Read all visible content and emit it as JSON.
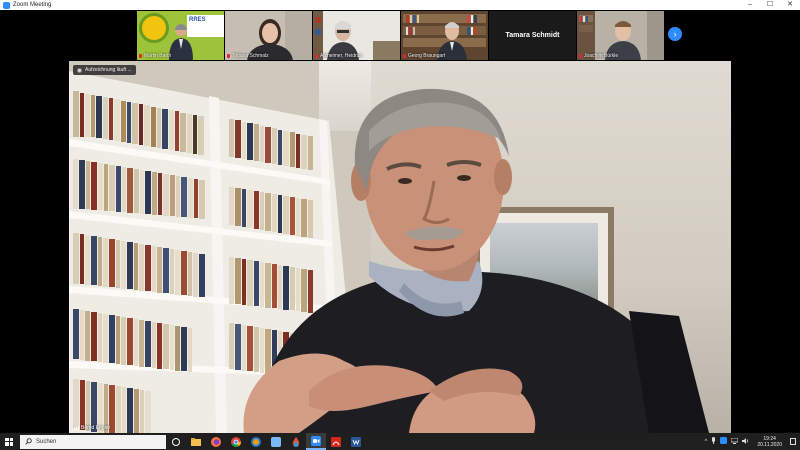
{
  "window": {
    "title": "Zoom Meeting",
    "controls": [
      "–",
      "☐",
      "✕"
    ]
  },
  "thumbnails": [
    {
      "name": "Martin Barth",
      "muted": true,
      "banner_text": "RRES"
    },
    {
      "name": "Tatjana Schmalz",
      "muted": true
    },
    {
      "name": "Alzheimer, Heidrun",
      "muted": true
    },
    {
      "name": "Georg Braungart",
      "muted": true
    },
    {
      "name": "Tamara Schmidt",
      "video_off": true
    },
    {
      "name": "Joachim Bürkle",
      "muted": true
    }
  ],
  "next_page_icon": "›",
  "main": {
    "recording_label": "Aufzeichnung läuft ...",
    "speaker_name": "Bernd Engler"
  },
  "taskbar": {
    "search_placeholder": "Suchen",
    "apps": [
      "task-view",
      "file-explorer",
      "firefox",
      "chrome",
      "firefox-alt",
      "zoom-alt",
      "drop",
      "zoom",
      "acrobat",
      "word"
    ],
    "active_app": "zoom",
    "tray_symbols": [
      "^",
      "🔊"
    ],
    "time": "19:24",
    "date": "20.11.2020"
  },
  "colors": {
    "zoom_blue": "#2d8cff",
    "taskbar": "#1f1f1f",
    "muted_red": "#e02828"
  }
}
